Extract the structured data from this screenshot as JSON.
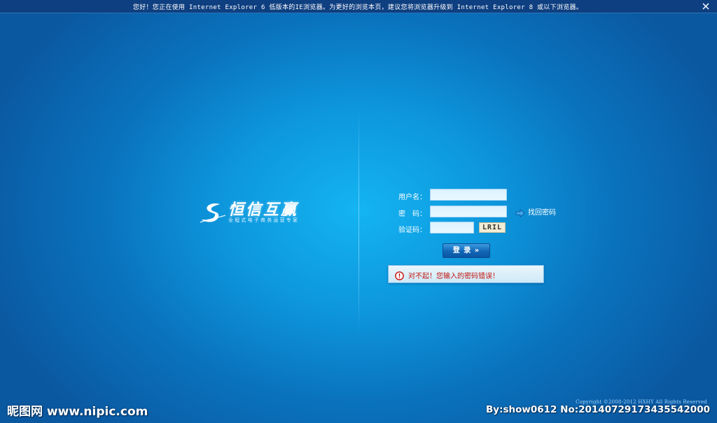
{
  "notice_bar": {
    "text": "您好！您正在使用 Internet Explorer 6 低版本的IE浏览器。为更好的浏览本页，建议您将浏览器升级到 Internet Explorer 8 或以下浏览器。",
    "close_icon": "close-icon"
  },
  "logo": {
    "title": "恒信互赢",
    "slogan": "全程式电子商务运营专家",
    "mark_icon": "swirl-logo-icon"
  },
  "login_form": {
    "username_label": "用户名：",
    "username_value": "",
    "password_label": "密　码：",
    "password_value": "",
    "captcha_label": "验证码：",
    "captcha_value": "",
    "captcha_image_text": "LRIL",
    "forgot_password_label": "找回密码",
    "forgot_icon": "arrow-right-icon",
    "submit_label": "登 录 »"
  },
  "error": {
    "icon": "error-circle-icon",
    "message": "对不起！您输入的密码错误！",
    "color": "#c2140e"
  },
  "footer": {
    "copyright": "Copyright ©2008-2012 HXHY All Rights Reserved"
  },
  "watermark": {
    "left": "昵图网 www.nipic.com",
    "right": "By:show0612 No:20140729173435542000"
  },
  "colors": {
    "background_center": "#14b4f2",
    "background_edge": "#0a58a0",
    "notice_bar": "#0e3f80",
    "input_fill": "#dbf2ff",
    "button": "#1266b6"
  }
}
